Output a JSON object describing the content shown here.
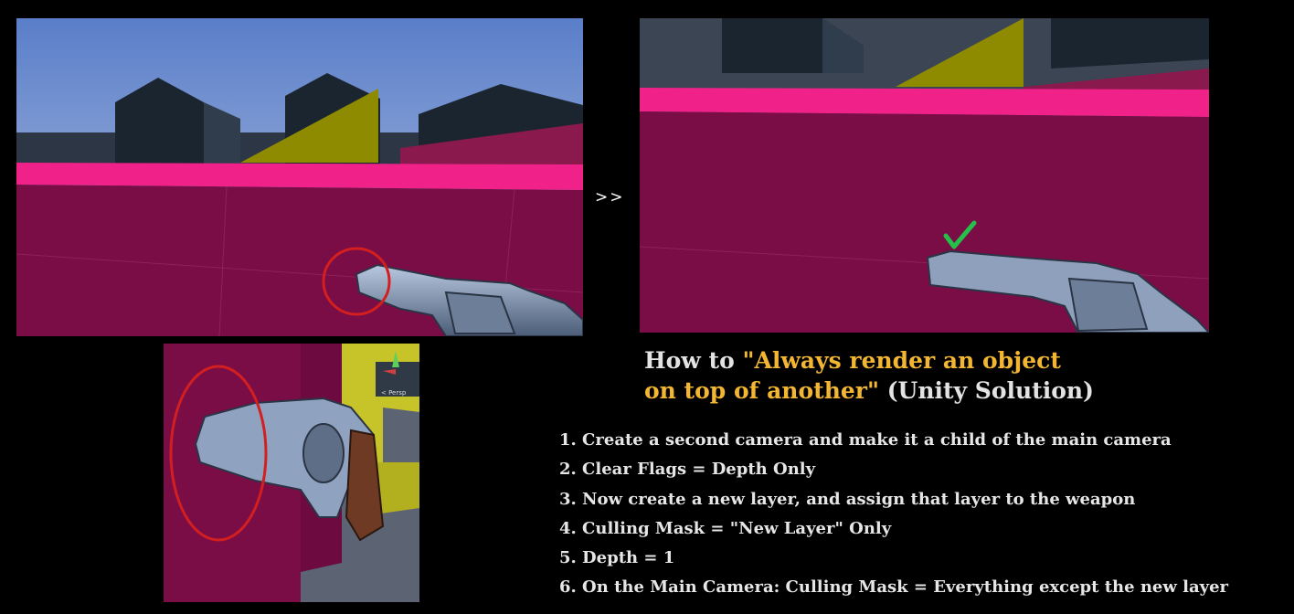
{
  "arrow": ">>",
  "title": {
    "prefix": "How to ",
    "highlight_line1": "\"Always render an object",
    "highlight_line2": "on top of another\"",
    "suffix": " (Unity Solution)"
  },
  "steps": [
    "1. Create a second camera and make it a child of the main camera",
    "2. Clear Flags = Depth Only",
    "3. Now create a new layer, and assign that layer to the weapon",
    "4. Culling Mask = \"New Layer\" Only",
    "5. Depth = 1",
    "6. On the Main Camera: Culling Mask = Everything except the new layer"
  ],
  "gizmo_label": "< Persp",
  "colors": {
    "sky": "#8aa6de",
    "wall": "#7a0c46",
    "wall_top": "#f0228a",
    "building": "#1b2530",
    "yellow": "#8e8b00",
    "highlight": "#f2b632",
    "check": "#25c04a",
    "circle": "#d21f1f"
  },
  "icons": [
    "revolver-icon",
    "red-circle-annotation",
    "green-checkmark-icon",
    "scene-gizmo-icon"
  ]
}
